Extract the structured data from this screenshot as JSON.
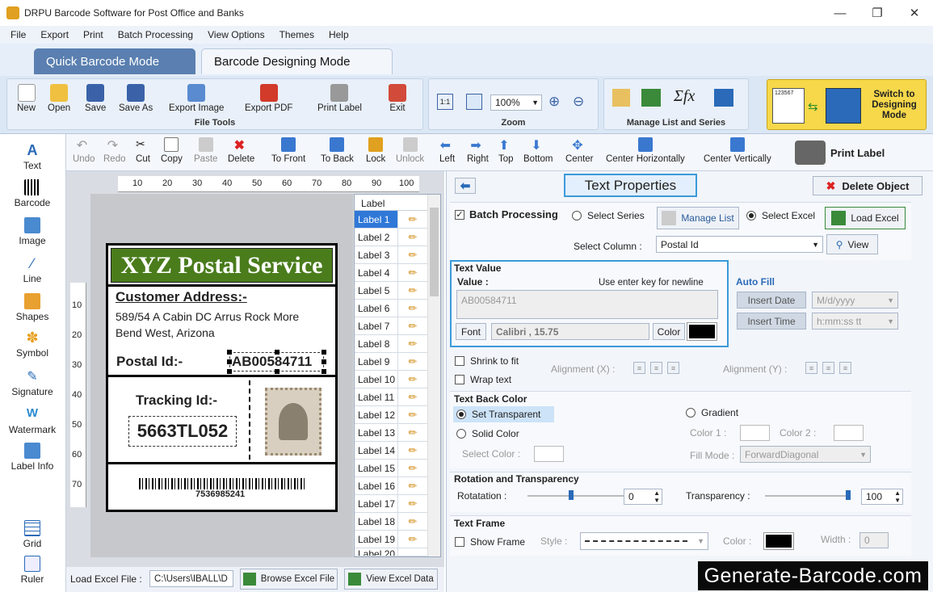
{
  "app": {
    "title": "DRPU Barcode Software for Post Office and Banks"
  },
  "menu": [
    "File",
    "Export",
    "Print",
    "Batch Processing",
    "View Options",
    "Themes",
    "Help"
  ],
  "modes": {
    "quick": "Quick Barcode Mode",
    "designing": "Barcode Designing Mode"
  },
  "ribbon": {
    "file_tools": {
      "title": "File Tools",
      "items": [
        "New",
        "Open",
        "Save",
        "Save As",
        "Export Image",
        "Export PDF",
        "Print Label",
        "Exit"
      ]
    },
    "zoom": {
      "title": "Zoom",
      "value": "100%"
    },
    "manage": {
      "title": "Manage List and Series"
    },
    "switch": {
      "label": "Switch to Designing Mode",
      "sample": "123567"
    }
  },
  "toolbar": {
    "items": [
      "Undo",
      "Redo",
      "Cut",
      "Copy",
      "Paste",
      "Delete",
      "To Front",
      "To Back",
      "Lock",
      "Unlock",
      "Left",
      "Right",
      "Top",
      "Bottom",
      "Center",
      "Center Horizontally",
      "Center Vertically"
    ],
    "print_label": "Print Label"
  },
  "sidebar": [
    "Text",
    "Barcode",
    "Image",
    "Line",
    "Shapes",
    "Symbol",
    "Signature",
    "Watermark",
    "Label Info",
    "Grid",
    "Ruler"
  ],
  "ruler": {
    "h": [
      "10",
      "20",
      "30",
      "40",
      "50",
      "60",
      "70",
      "80",
      "90",
      "100"
    ],
    "v": [
      "10",
      "20",
      "30",
      "40",
      "50",
      "60",
      "70"
    ]
  },
  "label_design": {
    "header": "XYZ Postal Service",
    "customer_title": "Customer Address:-",
    "address_line1": "589/54 A Cabin DC Arrus Rock More",
    "address_line2": "Bend West, Arizona",
    "postal_label": "Postal Id:-",
    "postal_value": "AB00584711",
    "tracking_label": "Tracking Id:-",
    "tracking_value": "5663TL052",
    "barcode_number": "7536985241"
  },
  "label_list": {
    "header": "Label",
    "items": [
      "Label 1",
      "Label 2",
      "Label 3",
      "Label 4",
      "Label 5",
      "Label 6",
      "Label 7",
      "Label 8",
      "Label 9",
      "Label 10",
      "Label 11",
      "Label 12",
      "Label 13",
      "Label 14",
      "Label 15",
      "Label 16",
      "Label 17",
      "Label 18",
      "Label 19",
      "Label 20"
    ]
  },
  "bottom": {
    "load_label": "Load Excel File :",
    "path": "C:\\Users\\IBALL\\D",
    "browse": "Browse Excel File",
    "view": "View Excel Data"
  },
  "props": {
    "title": "Text Properties",
    "delete": "Delete Object",
    "batch": "Batch Processing",
    "select_series": "Select Series",
    "manage_list": "Manage List",
    "select_excel": "Select Excel",
    "load_excel": "Load Excel",
    "select_column_label": "Select Column :",
    "select_column_value": "Postal Id",
    "view": "View",
    "text_value_title": "Text Value",
    "value_label": "Value :",
    "value_hint": "Use enter key for newline",
    "value": "AB00584711",
    "font_btn": "Font",
    "font_value": "Calibri , 15.75",
    "color_btn": "Color",
    "auto_fill": "Auto Fill",
    "insert_date": "Insert Date",
    "date_format": "M/d/yyyy",
    "insert_time": "Insert Time",
    "time_format": "h:mm:ss tt",
    "shrink": "Shrink to fit",
    "wrap": "Wrap text",
    "align_x": "Alignment (X) :",
    "align_y": "Alignment (Y) :",
    "back_color_title": "Text Back Color",
    "set_transparent": "Set Transparent",
    "gradient": "Gradient",
    "solid_color": "Solid Color",
    "color1": "Color 1 :",
    "color2": "Color 2 :",
    "select_color": "Select Color :",
    "fill_mode_label": "Fill Mode :",
    "fill_mode": "ForwardDiagonal",
    "rotation_title": "Rotation and Transparency",
    "rotation_label": "Rotatation :",
    "rotation_value": "0",
    "transparency_label": "Transparency :",
    "transparency_value": "100",
    "frame_title": "Text Frame",
    "show_frame": "Show Frame",
    "style_label": "Style :",
    "color_label": "Color :",
    "width_label": "Width :",
    "width_value": "0"
  },
  "watermark": "Generate-Barcode.com",
  "colors": {
    "accent": "#5a7fb0",
    "label_header": "#4a7c1c",
    "selection": "#2f78d8"
  }
}
